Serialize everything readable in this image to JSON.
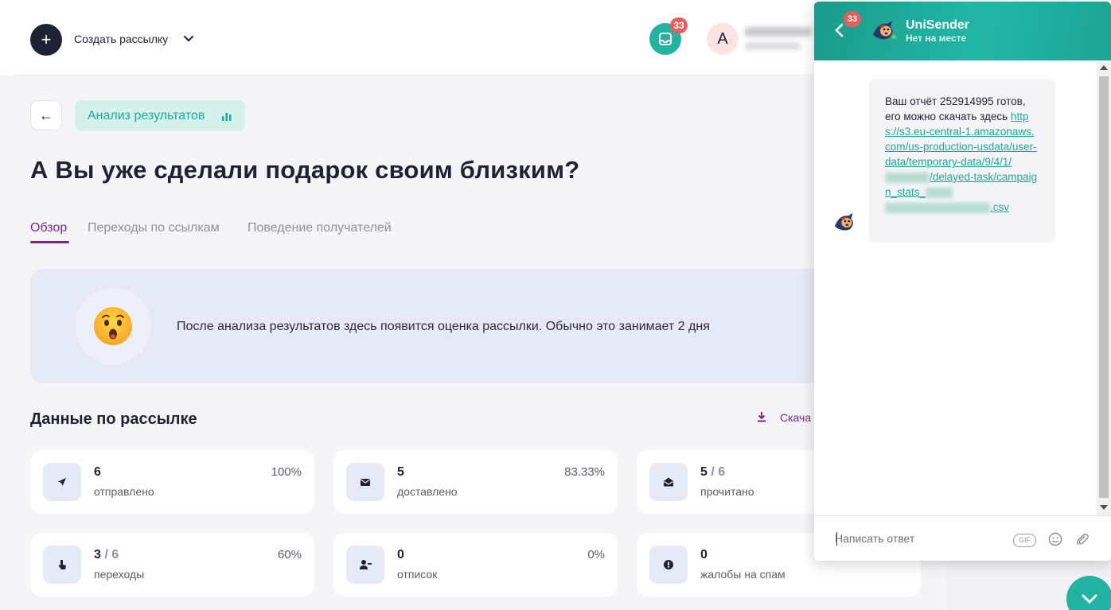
{
  "header": {
    "create_icon": "+",
    "create_label": "Создать рассылку",
    "inbox_badge": "33",
    "avatar_letter": "A"
  },
  "page": {
    "back_arrow": "←",
    "analysis_label": "Анализ результатов",
    "title": "А Вы уже сделали подарок своим близким?",
    "tabs": [
      {
        "label": "Обзор",
        "active": true
      },
      {
        "label": "Переходы по ссылкам",
        "active": false
      },
      {
        "label": "Поведение получателей",
        "active": false
      }
    ],
    "banner_text": "После анализа результатов здесь появится оценка рассылки. Обычно это занимает 2 дня",
    "section_title": "Данные по рассылке",
    "download_label": "Скача"
  },
  "cards": [
    {
      "icon": "send-icon",
      "value": "6",
      "total": "",
      "label": "отправлено",
      "percent": "100%"
    },
    {
      "icon": "envelope-icon",
      "value": "5",
      "total": "",
      "label": "доставлено",
      "percent": "83.33%"
    },
    {
      "icon": "open-envelope-icon",
      "value": "5",
      "total": " / 6",
      "label": "прочитано",
      "percent": ""
    },
    {
      "icon": "pointer-icon",
      "value": "3",
      "total": " / 6",
      "label": "переходы",
      "percent": "60%"
    },
    {
      "icon": "user-minus-icon",
      "value": "0",
      "total": "",
      "label": "отписок",
      "percent": "0%"
    },
    {
      "icon": "alert-icon",
      "value": "0",
      "total": "",
      "label": "жалобы на спам",
      "percent": ""
    }
  ],
  "chat": {
    "badge": "33",
    "name": "UniSender",
    "status": "Нет на месте",
    "message": {
      "text": "Ваш отчёт 252914995 готов, его можно скачать здесь",
      "link_part1": "https://s3.eu-central-1.amazonaws.com/us-production-usdata/user-data/temporary-data/9/4/1/",
      "link_part2": "/delayed-task/campaign_stats_",
      "link_part3": ".csv"
    },
    "input_placeholder": "Написать ответ",
    "gif_label": "GIF"
  },
  "colors": {
    "accent_purple": "#7a2a7b",
    "teal": "#22b3a5",
    "badge_red": "#e95d5d",
    "dark": "#1f2233"
  }
}
